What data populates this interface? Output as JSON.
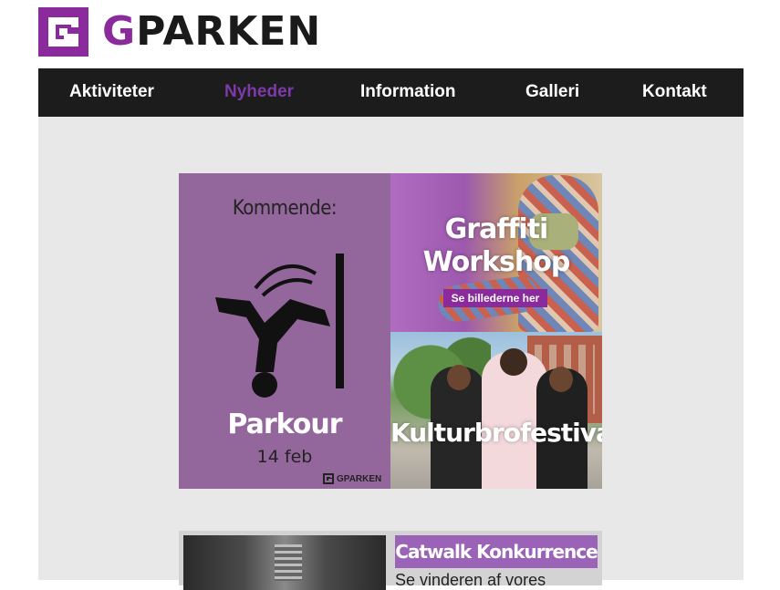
{
  "brand": {
    "logo_letter": "G",
    "logo_rest": "PARKEN",
    "accent": "#8a2a9c"
  },
  "nav": {
    "items": [
      {
        "label": "Aktiviteter",
        "active": false
      },
      {
        "label": "Nyheder",
        "active": true
      },
      {
        "label": "Information",
        "active": false
      },
      {
        "label": "Galleri",
        "active": false
      },
      {
        "label": "Kontakt",
        "active": false
      }
    ]
  },
  "main": {
    "parkour_poster": {
      "heading": "Kommende:",
      "title": "Parkour",
      "date": "14 feb",
      "brand": "GPARKEN",
      "icon": "parkour-figure-icon"
    },
    "graffiti": {
      "title_line1": "Graffiti",
      "title_line2": "Workshop",
      "cta": "Se billederne her"
    },
    "kultur": {
      "title": "Kulturbrofestival"
    },
    "catwalk": {
      "title": "Catwalk Konkurrence",
      "text": "Se vinderen af vores"
    }
  }
}
